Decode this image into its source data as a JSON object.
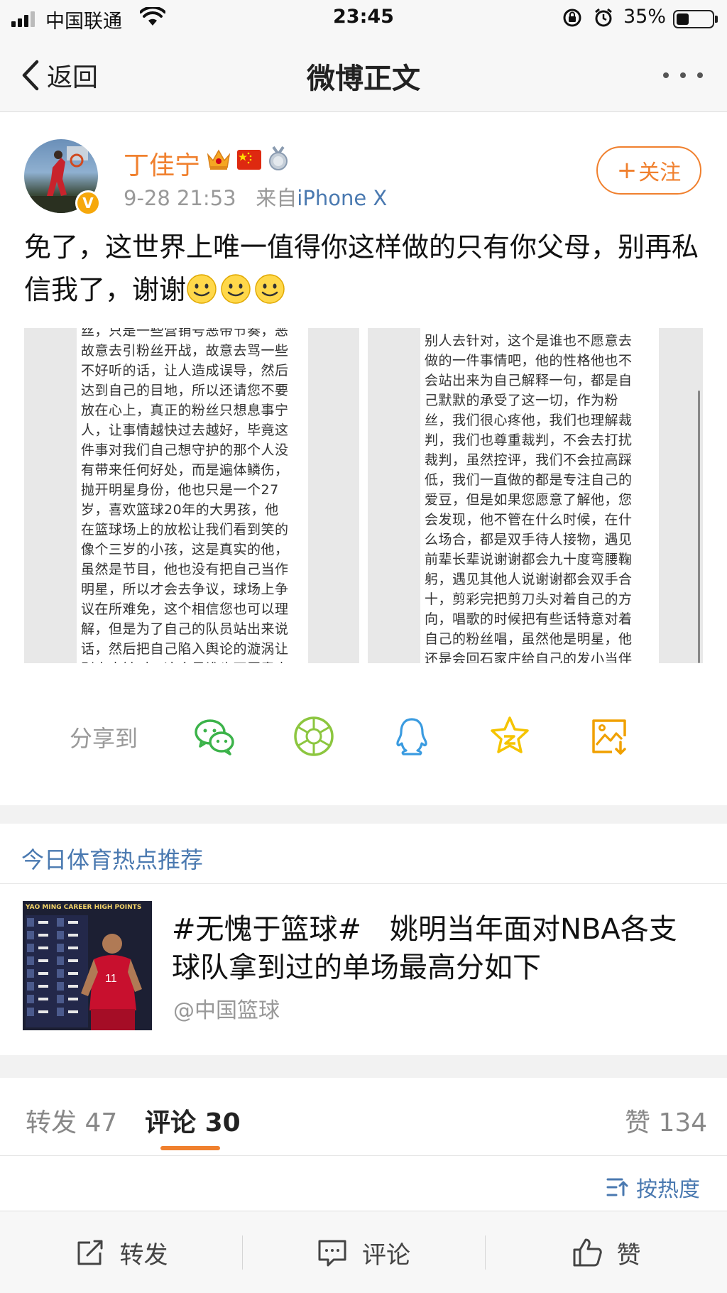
{
  "status_bar": {
    "carrier": "中国联通",
    "time": "23:45",
    "battery_percent": "35%",
    "battery_level": 0.35
  },
  "nav": {
    "back_label": "返回",
    "title": "微博正文"
  },
  "post": {
    "author_name": "丁佳宁",
    "verified_badge": "V",
    "timestamp": "9-28 21:53",
    "source_prefix": "来自",
    "source_device": "iPhone X",
    "follow_label": "关注",
    "text": "免了，这世界上唯一值得你这样做的只有你父母，别再私信我了，谢谢",
    "emoji_count": 3,
    "image_left_lines": [
      "丝，只是一些营销号恶带节奏，恶",
      "故意去引粉丝开战，故意去骂一些",
      "不好听的话，让人造成误导，然后",
      "达到自己的目地，所以还请您不要",
      "放在心上，真正的粉丝只想息事宁",
      "人，让事情越快过去越好，毕竟这",
      "件事对我们自己想守护的那个人没",
      "有带来任何好处，而是遍体鳞伤，",
      "抛开明星身份，他也只是一个27",
      "岁，喜欢篮球20年的大男孩，他",
      "在篮球场上的放松让我们看到笑的",
      "像个三岁的小孩，这是真实的他，",
      "虽然是节目，他也没有把自己当作",
      "明星，所以才会去争议，球场上争",
      "议在所难免，这个相信您也可以理",
      "解，但是为了自己的队员站出来说",
      "话，然后把自己陷入舆论的漩涡让",
      "别人去针对，这个是谁也不愿意去"
    ],
    "image_right_lines": [
      "别人去针对，这个是谁也不愿意去",
      "做的一件事情吧，他的性格他也不",
      "会站出来为自己解释一句，都是自",
      "己默默的承受了这一切，作为粉",
      "丝，我们很心疼他，我们也理解裁",
      "判，我们也尊重裁判，不会去打扰",
      "裁判，虽然控评，我们不会拉高踩",
      "低，我们一直做的都是专注自己的",
      "爱豆，但是如果您愿意了解他，您",
      "会发现，他不管在什么时候，在什",
      "么场合，都是双手待人接物，遇见",
      "前辈长辈说谢谢都会九十度弯腰鞠",
      "躬，遇见其他人说谢谢都会双手合",
      "十，剪彩完把剪刀头对着自己的方",
      "向，唱歌的时候把有些话特意对着",
      "自己的粉丝唱，虽然他是明星，他",
      "还是会回石家庄给自己的发小当伴"
    ]
  },
  "share": {
    "label": "分享到",
    "targets": [
      "wechat-icon",
      "moments-icon",
      "qq-icon",
      "qzone-icon",
      "save-image-icon"
    ],
    "colors": {
      "wechat": "#3cb34a",
      "moments": "#8cc63f",
      "qq": "#3a9be0",
      "qzone": "#f5c400",
      "save": "#f0a000"
    }
  },
  "hot": {
    "section_title": "今日体育热点推荐",
    "thumb_title": "YAO MING CAREER HIGH POINTS",
    "headline": "#无愧于篮球#　姚明当年面对NBA各支球队拿到过的单场最高分如下",
    "source": "@中国篮球"
  },
  "tabs": {
    "repost_label": "转发",
    "repost_count": "47",
    "comment_label": "评论",
    "comment_count": "30",
    "like_label": "赞",
    "like_count": "134"
  },
  "sort": {
    "label": "按热度"
  },
  "bottom_bar": {
    "repost": "转发",
    "comment": "评论",
    "like": "赞"
  },
  "colors": {
    "accent_orange": "#f0802e",
    "link_blue": "#4a79b0",
    "muted_gray": "#999999"
  }
}
